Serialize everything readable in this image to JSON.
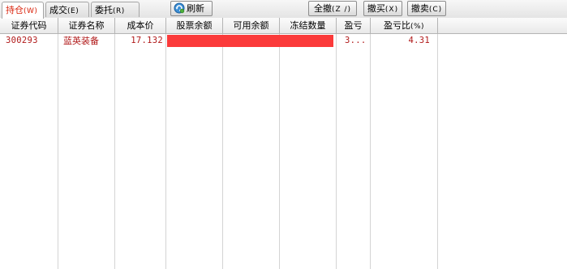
{
  "tabs": [
    {
      "label": "持仓",
      "key": "(W)"
    },
    {
      "label": "成交",
      "key": "(E)"
    },
    {
      "label": "委托",
      "key": "(R)"
    }
  ],
  "toolbar": {
    "refresh_label": "刷新",
    "cancel_all_label": "全撤",
    "cancel_all_key": "(Z /)",
    "cancel_buy_label": "撤买",
    "cancel_buy_key": "(X)",
    "cancel_sell_label": "撤卖",
    "cancel_sell_key": "(C)"
  },
  "columns": [
    {
      "label": "证券代码"
    },
    {
      "label": "证券名称"
    },
    {
      "label": "成本价"
    },
    {
      "label": "股票余额"
    },
    {
      "label": "可用余额"
    },
    {
      "label": "冻结数量"
    },
    {
      "label": "盈亏"
    },
    {
      "label": "盈亏比",
      "key": "(%)"
    }
  ],
  "rows": [
    {
      "code": "300293",
      "name": "蓝英装备",
      "cost": "17.132",
      "profit": "3...",
      "profit_pct": "4.31"
    }
  ],
  "colors": {
    "row_text": "#b01818",
    "active_tab": "#d81e06",
    "masked_bar": "#fb3a3a"
  }
}
